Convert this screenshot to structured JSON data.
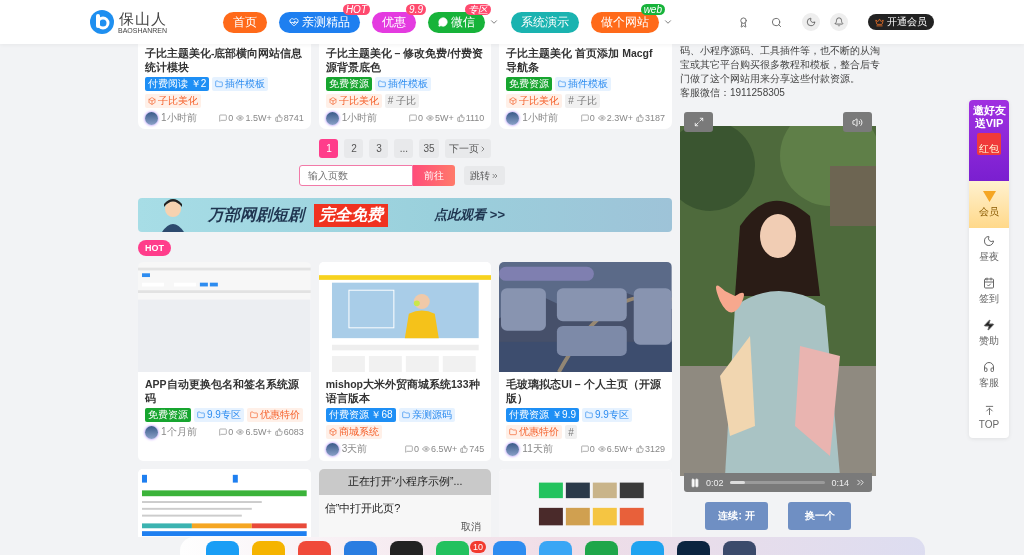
{
  "header": {
    "logo": {
      "name": "保山人",
      "sub": "BAOSHANREN"
    },
    "nav": [
      {
        "label": "首页",
        "color": "#ff6a1a"
      },
      {
        "label": "亲测精品",
        "color": "#1e7ff0",
        "badge": "HOT"
      },
      {
        "label": "优惠",
        "color": "#e43be0",
        "badge": "9.9"
      },
      {
        "label": "微信",
        "color": "#17b33a",
        "badge": "专区",
        "dropdown": true
      },
      {
        "label": "系统演示",
        "color": "#1ab3b0"
      },
      {
        "label": "做个网站",
        "color": "#ff6a1a",
        "badge": "web",
        "dropdown": true
      }
    ],
    "vip": "开通会员"
  },
  "top_cards": [
    {
      "title": "子比主题美化-底部横向网站信息统计模块",
      "tags": [
        {
          "kind": "paid",
          "label": "付费阅读 ￥2"
        },
        {
          "kind": "folder",
          "label": "插件模板"
        },
        {
          "kind": "cube",
          "label": "子比美化"
        }
      ],
      "time": "1小时前",
      "comments": "0",
      "views": "1.5W+",
      "likes": "8741"
    },
    {
      "title": "子比主题美化 – 修改免费/付费资源背景底色",
      "tags": [
        {
          "kind": "free",
          "label": "免费资源"
        },
        {
          "kind": "folder",
          "label": "插件模板"
        },
        {
          "kind": "cube",
          "label": "子比美化"
        },
        {
          "kind": "hash",
          "label": "# 子比"
        }
      ],
      "time": "1小时前",
      "comments": "0",
      "views": "5W+",
      "likes": "1110"
    },
    {
      "title": "子比主题美化 首页添加 Macgf 导航条",
      "tags": [
        {
          "kind": "free",
          "label": "免费资源"
        },
        {
          "kind": "folder",
          "label": "插件模板"
        },
        {
          "kind": "cube",
          "label": "子比美化"
        },
        {
          "kind": "hash",
          "label": "# 子比"
        }
      ],
      "time": "1小时前",
      "comments": "0",
      "views": "2.3W+",
      "likes": "3187"
    }
  ],
  "pagination": {
    "pages": [
      {
        "label": "1",
        "selected": true
      },
      {
        "label": "2",
        "selected": false
      },
      {
        "label": "3",
        "selected": false
      },
      {
        "label": "...",
        "selected": false
      },
      {
        "label": "35",
        "selected": false
      }
    ],
    "next": "下一页",
    "jump_placeholder": "输入页数",
    "go": "前往",
    "jump": "跳转"
  },
  "banner": {
    "title": "万部网剧短剧",
    "highlight": "完全免费",
    "action": "点此观看 >>"
  },
  "hot_badge": "HOT",
  "hot_cards": [
    {
      "title": "APP自动更换包名和签名系统源码",
      "tags": [
        {
          "kind": "free",
          "label": "免费资源"
        },
        {
          "kind": "folder",
          "label": "9.9专区"
        },
        {
          "kind": "sale",
          "label": "优惠特价"
        }
      ],
      "time": "1个月前",
      "comments": "0",
      "views": "6.5W+",
      "likes": "6083"
    },
    {
      "title": "mishop大米外贸商城系统133种语言版本",
      "tags": [
        {
          "kind": "paid",
          "label": "付费资源 ￥68"
        },
        {
          "kind": "folder",
          "label": "亲测源码"
        },
        {
          "kind": "cube",
          "label": "商城系统"
        }
      ],
      "time": "3天前",
      "comments": "0",
      "views": "6.5W+",
      "likes": "745"
    },
    {
      "title": "毛玻璃拟态UI – 个人主页（开源版）",
      "tags": [
        {
          "kind": "paid",
          "label": "付费资源 ￥9.9"
        },
        {
          "kind": "folder",
          "label": "9.9专区"
        },
        {
          "kind": "sale",
          "label": "优惠特价"
        },
        {
          "kind": "hash",
          "label": "#"
        }
      ],
      "time": "11天前",
      "comments": "0",
      "views": "6.5W+",
      "likes": "3129"
    }
  ],
  "more_cards": [
    {
      "kind": "picture"
    },
    {
      "kind": "dialog",
      "heading": "正在打开“小程序示例”...",
      "question": "信”中打开此页?",
      "cancel": "取消"
    },
    {
      "kind": "picture"
    }
  ],
  "side_panel": {
    "intro": "码、小程序源码、工具插件等，也不断的从淘宝或其它平台购买很多教程和模板，整合后专门做了这个网站用来分享这些付款资源。",
    "contact": "客服微信：1911258305",
    "video": {
      "current": "0:02",
      "duration": "0:14",
      "level": 0.16
    },
    "buttons": [
      "连续: 开",
      "换一个"
    ]
  },
  "float_bar": {
    "invite": "邀好友送VIP",
    "packet": "红包",
    "member": "会员",
    "items": [
      {
        "kind": "moon",
        "label": "昼夜"
      },
      {
        "kind": "calendar",
        "label": "签到"
      },
      {
        "kind": "bolt",
        "label": "赞助"
      },
      {
        "kind": "headset",
        "label": "客服"
      },
      {
        "kind": "top",
        "label": "TOP"
      }
    ]
  },
  "dock": [
    {
      "color": "#1a9ef5"
    },
    {
      "color": "#f5b400"
    },
    {
      "color": "#f04a3a"
    },
    {
      "color": "#2a7de1"
    },
    {
      "color": "#222222"
    },
    {
      "color": "#22c15e",
      "badge": "10"
    },
    {
      "color": "#2d8cf0"
    },
    {
      "color": "#3aa6f5"
    },
    {
      "color": "#1fa64a"
    },
    {
      "color": "#1fa3f0"
    },
    {
      "color": "#0b2440"
    },
    {
      "color": "#3b4a6b"
    }
  ]
}
